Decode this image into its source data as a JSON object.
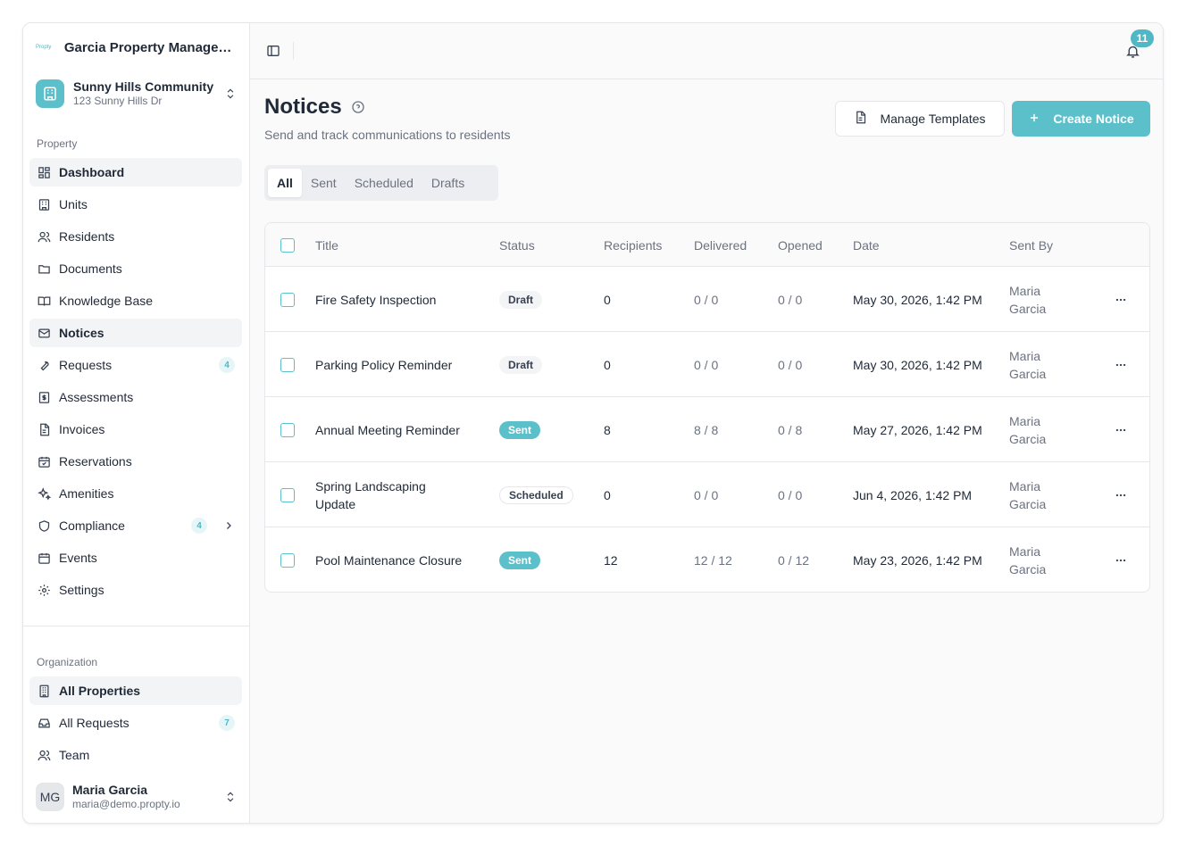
{
  "org": {
    "logo_text": "Propty",
    "name": "Garcia Property Managem..."
  },
  "property": {
    "name": "Sunny Hills Community",
    "address": "123 Sunny Hills Dr"
  },
  "sidebar": {
    "property_label": "Property",
    "items": [
      {
        "label": "Dashboard",
        "icon": "dashboard-icon"
      },
      {
        "label": "Units",
        "icon": "building-icon"
      },
      {
        "label": "Residents",
        "icon": "users-icon"
      },
      {
        "label": "Documents",
        "icon": "folder-icon"
      },
      {
        "label": "Knowledge Base",
        "icon": "book-icon"
      },
      {
        "label": "Notices",
        "icon": "mail-icon"
      },
      {
        "label": "Requests",
        "icon": "wrench-icon",
        "badge": "4"
      },
      {
        "label": "Assessments",
        "icon": "dollar-doc-icon"
      },
      {
        "label": "Invoices",
        "icon": "file-icon"
      },
      {
        "label": "Reservations",
        "icon": "calendar-check-icon"
      },
      {
        "label": "Amenities",
        "icon": "sparkles-icon"
      },
      {
        "label": "Compliance",
        "icon": "shield-icon",
        "badge": "4"
      },
      {
        "label": "Events",
        "icon": "calendar-icon"
      },
      {
        "label": "Settings",
        "icon": "gear-icon"
      }
    ],
    "org_label": "Organization",
    "org_items": [
      {
        "label": "All Properties",
        "icon": "office-icon"
      },
      {
        "label": "All Requests",
        "icon": "inbox-icon",
        "badge": "7"
      },
      {
        "label": "Team",
        "icon": "users-icon"
      }
    ]
  },
  "user": {
    "initials": "MG",
    "name": "Maria Garcia",
    "email": "maria@demo.propty.io"
  },
  "topbar": {
    "notifications": "11"
  },
  "page": {
    "title": "Notices",
    "subtitle": "Send and track communications to residents",
    "manage_templates": "Manage Templates",
    "create_notice": "Create Notice"
  },
  "tabs": [
    "All",
    "Sent",
    "Scheduled",
    "Drafts"
  ],
  "table": {
    "headers": [
      "Title",
      "Status",
      "Recipients",
      "Delivered",
      "Opened",
      "Date",
      "Sent By"
    ],
    "rows": [
      {
        "title": "Fire Safety Inspection",
        "status": "Draft",
        "recipients": "0",
        "delivered": "0 / 0",
        "opened": "0 / 0",
        "date": "May 30, 2026, 1:42 PM",
        "sent_by": "Maria Garcia"
      },
      {
        "title": "Parking Policy Reminder",
        "status": "Draft",
        "recipients": "0",
        "delivered": "0 / 0",
        "opened": "0 / 0",
        "date": "May 30, 2026, 1:42 PM",
        "sent_by": "Maria Garcia"
      },
      {
        "title": "Annual Meeting Reminder",
        "status": "Sent",
        "recipients": "8",
        "delivered": "8 / 8",
        "opened": "0 / 8",
        "date": "May 27, 2026, 1:42 PM",
        "sent_by": "Maria Garcia"
      },
      {
        "title": "Spring Landscaping Update",
        "status": "Scheduled",
        "recipients": "0",
        "delivered": "0 / 0",
        "opened": "0 / 0",
        "date": "Jun 4, 2026, 1:42 PM",
        "sent_by": "Maria Garcia"
      },
      {
        "title": "Pool Maintenance Closure",
        "status": "Sent",
        "recipients": "12",
        "delivered": "12 / 12",
        "opened": "0 / 12",
        "date": "May 23, 2026, 1:42 PM",
        "sent_by": "Maria Garcia"
      }
    ]
  },
  "colors": {
    "accent": "#5cc0cb",
    "text": "#1f2937",
    "muted": "#6b7280",
    "border": "#e5e7eb"
  }
}
